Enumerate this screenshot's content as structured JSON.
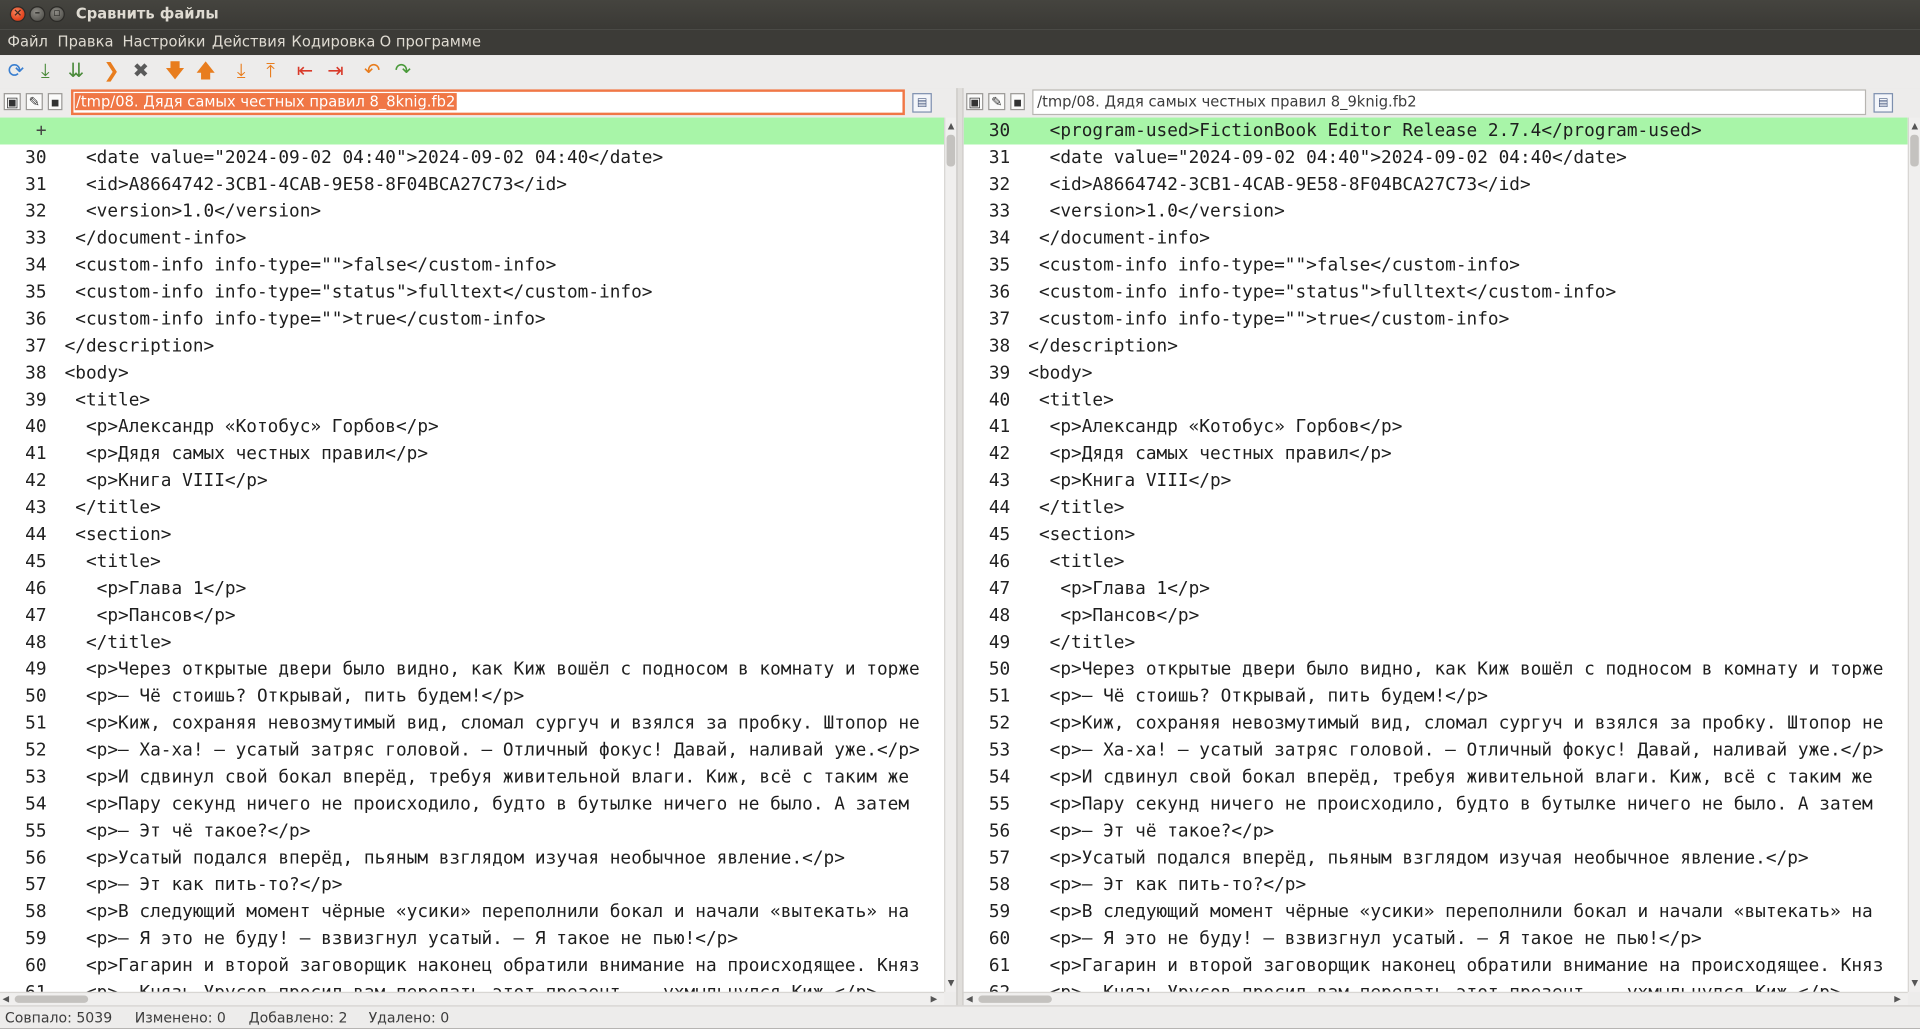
{
  "window": {
    "title": "Сравнить файлы"
  },
  "menu": [
    "Файл",
    "Правка",
    "Настройки",
    "Действия",
    "Кодировка",
    "О программе"
  ],
  "toolbar": {
    "buttons": [
      {
        "name": "refresh-icon",
        "glyph": "⟳",
        "color": "#3a7fd0"
      },
      {
        "name": "save-down-icon",
        "glyph": "⤓",
        "color": "#4a8a3a"
      },
      {
        "name": "save-all-icon",
        "glyph": "⇊",
        "color": "#4a8a3a"
      },
      {
        "name": "chevron-right-icon",
        "glyph": "❯",
        "color": "#e87d1e"
      },
      {
        "name": "stop-icon",
        "glyph": "✖",
        "color": "#5a5a5a"
      },
      {
        "name": "next-diff-icon",
        "glyph": "🡇",
        "color": "#e87d1e"
      },
      {
        "name": "prev-diff-icon",
        "glyph": "🡅",
        "color": "#e87d1e"
      },
      {
        "name": "last-diff-icon",
        "glyph": "⤓",
        "color": "#e87d1e"
      },
      {
        "name": "first-diff-icon",
        "glyph": "⤒",
        "color": "#e87d1e"
      },
      {
        "name": "copy-left-icon",
        "glyph": "⇤",
        "color": "#d93a2a"
      },
      {
        "name": "copy-right-icon",
        "glyph": "⇥",
        "color": "#d93a2a"
      },
      {
        "name": "undo-icon",
        "glyph": "↶",
        "color": "#e87d1e"
      },
      {
        "name": "redo-icon",
        "glyph": "↷",
        "color": "#4a9a3a"
      }
    ]
  },
  "left": {
    "path": "/tmp/08. Дядя самых честных правил 8_8knig.fb2",
    "lines": [
      {
        "n": "+",
        "text": "",
        "added": true
      },
      {
        "n": "30",
        "text": "   <date value=\"2024-09-02 04:40\">2024-09-02 04:40</date>"
      },
      {
        "n": "31",
        "text": "   <id>A8664742-3CB1-4CAB-9E58-8F04BCA27C73</id>"
      },
      {
        "n": "32",
        "text": "   <version>1.0</version>"
      },
      {
        "n": "33",
        "text": "  </document-info>"
      },
      {
        "n": "34",
        "text": "  <custom-info info-type=\"\">false</custom-info>"
      },
      {
        "n": "35",
        "text": "  <custom-info info-type=\"status\">fulltext</custom-info>"
      },
      {
        "n": "36",
        "text": "  <custom-info info-type=\"\">true</custom-info>"
      },
      {
        "n": "37",
        "text": " </description>"
      },
      {
        "n": "38",
        "text": " <body>"
      },
      {
        "n": "39",
        "text": "  <title>"
      },
      {
        "n": "40",
        "text": "   <p>Александр «Котобус» Горбов</p>"
      },
      {
        "n": "41",
        "text": "   <p>Дядя самых честных правил</p>"
      },
      {
        "n": "42",
        "text": "   <p>Книга VIII</p>"
      },
      {
        "n": "43",
        "text": "  </title>"
      },
      {
        "n": "44",
        "text": "  <section>"
      },
      {
        "n": "45",
        "text": "   <title>"
      },
      {
        "n": "46",
        "text": "    <p>Глава 1</p>"
      },
      {
        "n": "47",
        "text": "    <p>Пансов</p>"
      },
      {
        "n": "48",
        "text": "   </title>"
      },
      {
        "n": "49",
        "text": "   <p>Через открытые двери было видно, как Киж вошёл с подносом в комнату и торже"
      },
      {
        "n": "50",
        "text": "   <p>— Чё стоишь? Открывай, пить будем!</p>"
      },
      {
        "n": "51",
        "text": "   <p>Киж, сохраняя невозмутимый вид, сломал сургуч и взялся за пробку. Штопор не"
      },
      {
        "n": "52",
        "text": "   <p>— Ха-ха! — усатый затряс головой. — Отличный фокус! Давай, наливай уже.</p>"
      },
      {
        "n": "53",
        "text": "   <p>И сдвинул свой бокал вперёд, требуя живительной влаги. Киж, всё с таким же"
      },
      {
        "n": "54",
        "text": "   <p>Пару секунд ничего не происходило, будто в бутылке ничего не было. А затем"
      },
      {
        "n": "55",
        "text": "   <p>— Эт чё такое?</p>"
      },
      {
        "n": "56",
        "text": "   <p>Усатый подался вперёд, пьяным взглядом изучая необычное явление.</p>"
      },
      {
        "n": "57",
        "text": "   <p>— Эт как пить-то?</p>"
      },
      {
        "n": "58",
        "text": "   <p>В следующий момент чёрные «усики» переполнили бокал и начали «вытекать» на"
      },
      {
        "n": "59",
        "text": "   <p>— Я это не буду! — взвизгнул усатый. — Я такое не пью!</p>"
      },
      {
        "n": "60",
        "text": "   <p>Гагарин и второй заговорщик наконец обратили внимание на происходящее. Княз"
      },
      {
        "n": "61",
        "text": "   <p>— Князь Урусов просил вам передать этот презент, — ухмыльнулся Киж.</p>"
      }
    ]
  },
  "right": {
    "path": "/tmp/08. Дядя самых честных правил 8_9knig.fb2",
    "lines": [
      {
        "n": "30",
        "text": "   <program-used>FictionBook Editor Release 2.7.4</program-used>",
        "added": true
      },
      {
        "n": "31",
        "text": "   <date value=\"2024-09-02 04:40\">2024-09-02 04:40</date>"
      },
      {
        "n": "32",
        "text": "   <id>A8664742-3CB1-4CAB-9E58-8F04BCA27C73</id>"
      },
      {
        "n": "33",
        "text": "   <version>1.0</version>"
      },
      {
        "n": "34",
        "text": "  </document-info>"
      },
      {
        "n": "35",
        "text": "  <custom-info info-type=\"\">false</custom-info>"
      },
      {
        "n": "36",
        "text": "  <custom-info info-type=\"status\">fulltext</custom-info>"
      },
      {
        "n": "37",
        "text": "  <custom-info info-type=\"\">true</custom-info>"
      },
      {
        "n": "38",
        "text": " </description>"
      },
      {
        "n": "39",
        "text": " <body>"
      },
      {
        "n": "40",
        "text": "  <title>"
      },
      {
        "n": "41",
        "text": "   <p>Александр «Котобус» Горбов</p>"
      },
      {
        "n": "42",
        "text": "   <p>Дядя самых честных правил</p>"
      },
      {
        "n": "43",
        "text": "   <p>Книга VIII</p>"
      },
      {
        "n": "44",
        "text": "  </title>"
      },
      {
        "n": "45",
        "text": "  <section>"
      },
      {
        "n": "46",
        "text": "   <title>"
      },
      {
        "n": "47",
        "text": "    <p>Глава 1</p>"
      },
      {
        "n": "48",
        "text": "    <p>Пансов</p>"
      },
      {
        "n": "49",
        "text": "   </title>"
      },
      {
        "n": "50",
        "text": "   <p>Через открытые двери было видно, как Киж вошёл с подносом в комнату и торже"
      },
      {
        "n": "51",
        "text": "   <p>— Чё стоишь? Открывай, пить будем!</p>"
      },
      {
        "n": "52",
        "text": "   <p>Киж, сохраняя невозмутимый вид, сломал сургуч и взялся за пробку. Штопор не"
      },
      {
        "n": "53",
        "text": "   <p>— Ха-ха! — усатый затряс головой. — Отличный фокус! Давай, наливай уже.</p>"
      },
      {
        "n": "54",
        "text": "   <p>И сдвинул свой бокал вперёд, требуя живительной влаги. Киж, всё с таким же"
      },
      {
        "n": "55",
        "text": "   <p>Пару секунд ничего не происходило, будто в бутылке ничего не было. А затем"
      },
      {
        "n": "56",
        "text": "   <p>— Эт чё такое?</p>"
      },
      {
        "n": "57",
        "text": "   <p>Усатый подался вперёд, пьяным взглядом изучая необычное явление.</p>"
      },
      {
        "n": "58",
        "text": "   <p>— Эт как пить-то?</p>"
      },
      {
        "n": "59",
        "text": "   <p>В следующий момент чёрные «усики» переполнили бокал и начали «вытекать» на"
      },
      {
        "n": "60",
        "text": "   <p>— Я это не буду! — взвизгнул усатый. — Я такое не пью!</p>"
      },
      {
        "n": "61",
        "text": "   <p>Гагарин и второй заговорщик наконец обратили внимание на происходящее. Княз"
      },
      {
        "n": "62",
        "text": "   <p>— Князь Урусов просил вам передать этот презент, — ухмыльнулся Киж.</p>"
      }
    ]
  },
  "status": {
    "matched": "Совпало: 5039",
    "changed": "Изменено: 0",
    "added": "Добавлено: 2",
    "deleted": "Удалено: 0"
  },
  "colors": {
    "added_bg": "#a8f5a8",
    "selection": "#f07746"
  }
}
